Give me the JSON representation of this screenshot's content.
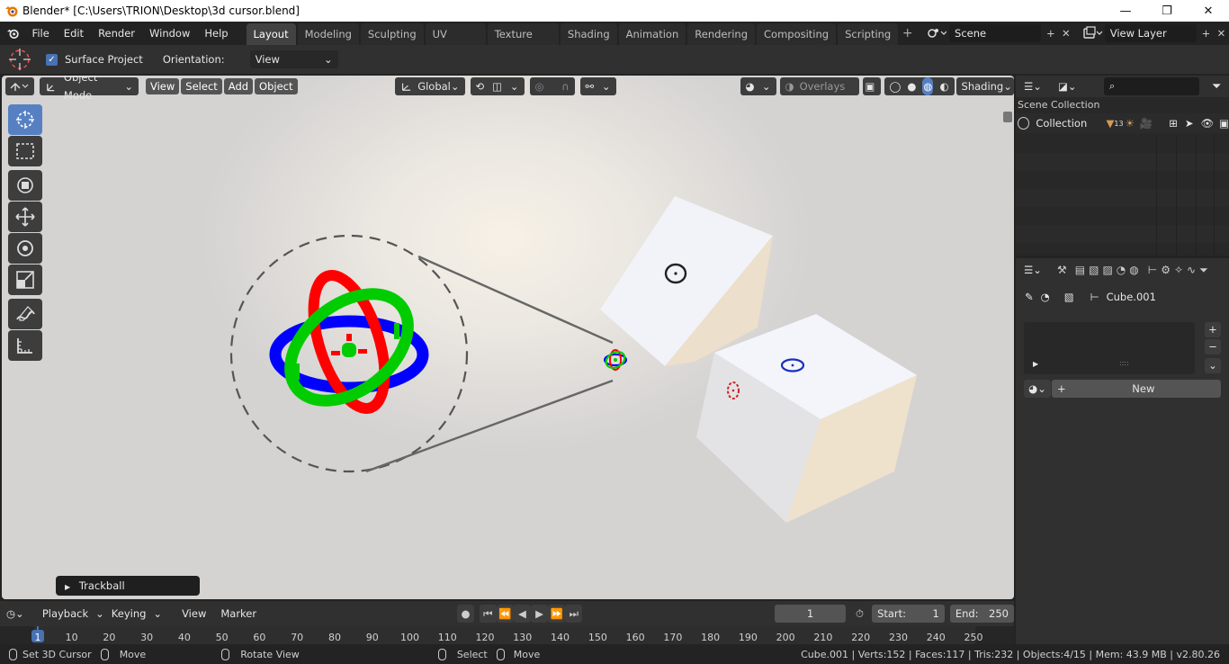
{
  "window": {
    "title": "Blender* [C:\\Users\\TRION\\Desktop\\3d cursor.blend]",
    "minimize": "—",
    "maximize": "❐",
    "close": "✕"
  },
  "menubar": {
    "menus": [
      "File",
      "Edit",
      "Render",
      "Window",
      "Help"
    ],
    "workspaces": [
      "Layout",
      "Modeling",
      "Sculpting",
      "UV Editing",
      "Texture Paint",
      "Shading",
      "Animation",
      "Rendering",
      "Compositing",
      "Scripting"
    ],
    "active_workspace": "Layout",
    "add_workspace": "+",
    "scene": "Scene",
    "view_layer": "View Layer"
  },
  "toolheader": {
    "surface_project": "Surface Project",
    "orientation_label": "Orientation:",
    "orientation_value": "View"
  },
  "viewport_header": {
    "mode": "Object Mode",
    "menus": [
      "View",
      "Select",
      "Add",
      "Object"
    ],
    "transform_orientation": "Global",
    "overlays": "Overlays",
    "shading": "Shading"
  },
  "trackball_panel": {
    "label": "Trackball"
  },
  "outliner": {
    "search_placeholder": "",
    "root": "Scene Collection",
    "collection": "Collection",
    "badge": "13"
  },
  "properties": {
    "object_name": "Cube.001",
    "new_button": "New"
  },
  "timeline": {
    "menus": [
      "Playback",
      "Keying",
      "View",
      "Marker"
    ],
    "current_frame": "1",
    "start_label": "Start:",
    "start_value": "1",
    "end_label": "End:",
    "end_value": "250",
    "ruler_ticks": [
      "1",
      "10",
      "20",
      "30",
      "40",
      "50",
      "60",
      "70",
      "80",
      "90",
      "100",
      "110",
      "120",
      "130",
      "140",
      "150",
      "160",
      "170",
      "180",
      "190",
      "200",
      "210",
      "220",
      "230",
      "240",
      "250"
    ]
  },
  "statusbar": {
    "hint1": "Set 3D Cursor",
    "hint2": "Move",
    "hint3": "Rotate View",
    "hint4": "Select",
    "hint5": "Move",
    "stats": "Cube.001 | Verts:152 | Faces:117 | Tris:232 | Objects:4/15 | Mem: 43.9 MB | v2.80.26"
  },
  "colors": {
    "accent": "#4772b3",
    "active_tab": "#424242",
    "header": "#303030",
    "background": "#232323",
    "cursor_red": "#ff0000",
    "cursor_green": "#00cc00",
    "cursor_blue": "#0000ff"
  }
}
